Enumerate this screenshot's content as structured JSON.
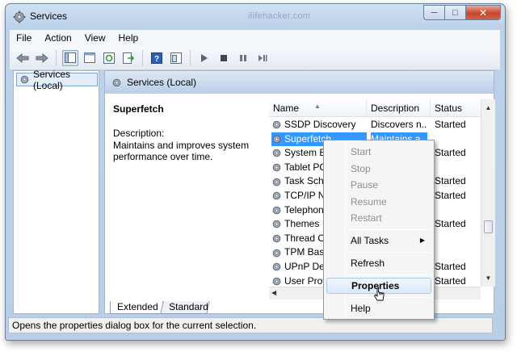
{
  "window": {
    "title": "Services",
    "watermark": "ilifehacker.com"
  },
  "menu": [
    "File",
    "Action",
    "View",
    "Help"
  ],
  "toolbar": {
    "buttons": [
      "back-icon",
      "forward-icon",
      "show-tree-icon",
      "console-icon",
      "refresh-icon",
      "export-icon",
      "help-icon",
      "properties-icon",
      "play-icon",
      "stop-icon",
      "pause-icon",
      "restart-icon"
    ]
  },
  "tree": {
    "item": "Services (Local)"
  },
  "pane": {
    "header": "Services (Local)",
    "selected_name": "Superfetch",
    "description_label": "Description:",
    "description": "Maintains and improves system performance over time."
  },
  "list": {
    "columns": [
      "Name",
      "Description",
      "Status"
    ],
    "rows": [
      {
        "name": "SSDP Discovery",
        "description": "Discovers n...",
        "status": "Started"
      },
      {
        "name": "Superfetch",
        "description": "Maintains a...",
        "status": ""
      },
      {
        "name": "System Ev",
        "description": "",
        "status": "Started"
      },
      {
        "name": "Tablet PC",
        "description": "",
        "status": ""
      },
      {
        "name": "Task Sche",
        "description": "",
        "status": "Started"
      },
      {
        "name": "TCP/IP Ne",
        "description": "",
        "status": "Started"
      },
      {
        "name": "Telephon",
        "description": "",
        "status": ""
      },
      {
        "name": "Themes",
        "description": "",
        "status": "Started"
      },
      {
        "name": "Thread Or",
        "description": "",
        "status": ""
      },
      {
        "name": "TPM Base",
        "description": "",
        "status": ""
      },
      {
        "name": "UPnP Dev",
        "description": "",
        "status": "Started"
      },
      {
        "name": "User Profi",
        "description": "",
        "status": "Started"
      }
    ]
  },
  "tabs": [
    "Extended",
    "Standard"
  ],
  "context_menu": {
    "items": [
      "Start",
      "Stop",
      "Pause",
      "Resume",
      "Restart",
      "All Tasks",
      "Refresh",
      "Properties",
      "Help"
    ]
  },
  "statusbar": "Opens the properties dialog box for the current selection."
}
